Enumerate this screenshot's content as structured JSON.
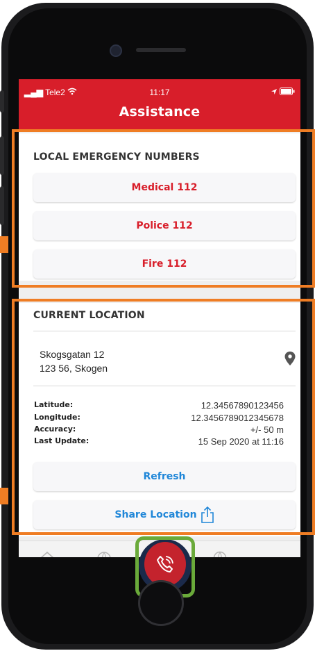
{
  "status_bar": {
    "carrier": "Tele2",
    "time": "11:17"
  },
  "header": {
    "title": "Assistance"
  },
  "emergency": {
    "heading": "LOCAL EMERGENCY NUMBERS",
    "buttons": [
      {
        "label": "Medical 112"
      },
      {
        "label": "Police 112"
      },
      {
        "label": "Fire 112"
      }
    ]
  },
  "location": {
    "heading": "CURRENT LOCATION",
    "address_line1": "Skogsgatan 12",
    "address_line2": "123 56, Skogen",
    "rows": [
      {
        "label": "Latitude:",
        "value": "12.34567890123456"
      },
      {
        "label": "Longitude:",
        "value": "12.3456789012345678"
      },
      {
        "label": "Accuracy:",
        "value": "+/- 50 m"
      },
      {
        "label": "Last Update:",
        "value": "15 Sep 2020 at 11:16"
      }
    ],
    "refresh_label": "Refresh",
    "share_label": "Share Location"
  },
  "tabbar": {
    "tabs": [
      "home-icon",
      "globe-warning-icon",
      "phone-call-icon",
      "globe-document-icon",
      "more-icon"
    ]
  },
  "colors": {
    "brand_red": "#d81e2a",
    "link_blue": "#1f86d8",
    "highlight_orange": "#ef7d24",
    "highlight_green": "#6aaa3a",
    "call_navy": "#1b2a4a"
  }
}
